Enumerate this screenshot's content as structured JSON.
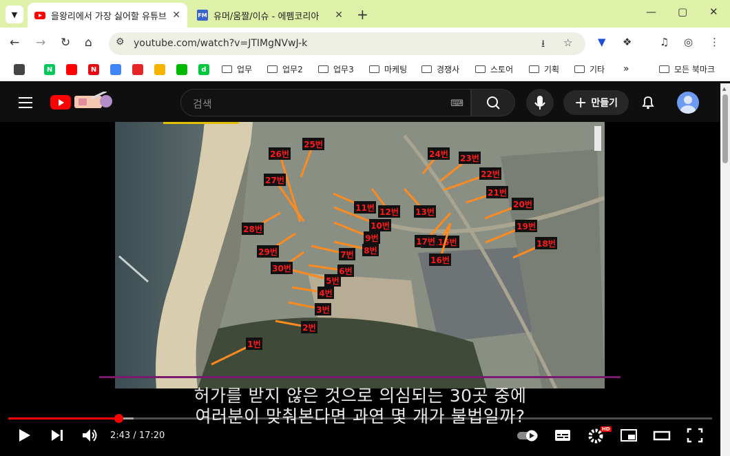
{
  "browser": {
    "tabs": [
      {
        "title": "을왕리에서 가장 싫어할 유튜브",
        "favicon": "youtube-favicon",
        "active": true
      },
      {
        "title": "유머/움짤/이슈 - 에펨코리아",
        "favicon": "fmkorea-favicon",
        "favicon_text": "FM",
        "active": false
      }
    ],
    "url": "youtube.com/watch?v=JTIMgNVwJ-k",
    "bookmarks": [
      {
        "label": "업무"
      },
      {
        "label": "업무2"
      },
      {
        "label": "업무3"
      },
      {
        "label": "마케팅"
      },
      {
        "label": "경쟁사"
      },
      {
        "label": "스토어"
      },
      {
        "label": "기획"
      },
      {
        "label": "기타"
      }
    ],
    "bookmark_icons": [
      {
        "name": "apps-grid-icon",
        "color": "#444444",
        "text": ""
      },
      {
        "name": "naver-icon",
        "color": "#03c75a",
        "text": "N"
      },
      {
        "name": "youtube-icon",
        "color": "#ff0000",
        "text": ""
      },
      {
        "name": "netflix-icon",
        "color": "#e50914",
        "text": "N"
      },
      {
        "name": "play-store-icon",
        "color": "#4285f4",
        "text": ""
      },
      {
        "name": "coupang-icon",
        "color": "#e52528",
        "text": ""
      },
      {
        "name": "folder-app-icon",
        "color": "#f4b400",
        "text": ""
      },
      {
        "name": "line-icon",
        "color": "#00b900",
        "text": ""
      },
      {
        "name": "d-icon",
        "color": "#00c73c",
        "text": "d"
      }
    ],
    "bookmarks_overflow": "»",
    "all_bookmarks": "모든 북마크"
  },
  "youtube": {
    "search_placeholder": "검색",
    "create_label": "만들기",
    "subtitle_line1": "허가를 받지 않은 것으로 의심되는 30곳 중에",
    "subtitle_line2": "여러분이 맞춰본다면 과연 몇 개가 불법일까?",
    "time_display": "2:43 / 17:20",
    "progress_fraction": 0.157,
    "settings_badge": "HD",
    "map_labels": [
      "1번",
      "2번",
      "3번",
      "4번",
      "5번",
      "6번",
      "7번",
      "8번",
      "9번",
      "10번",
      "11번",
      "12번",
      "13번",
      "14,15번",
      "16번",
      "17번",
      "18번",
      "19번",
      "20번",
      "21번",
      "22번",
      "23번",
      "24번",
      "25번",
      "26번",
      "27번",
      "28번",
      "29번",
      "30번"
    ]
  },
  "colors": {
    "accent_red": "#ff0000",
    "tab_strip": "#dff0a8",
    "label_text": "#ff1a1a",
    "label_bg": "#111111"
  }
}
